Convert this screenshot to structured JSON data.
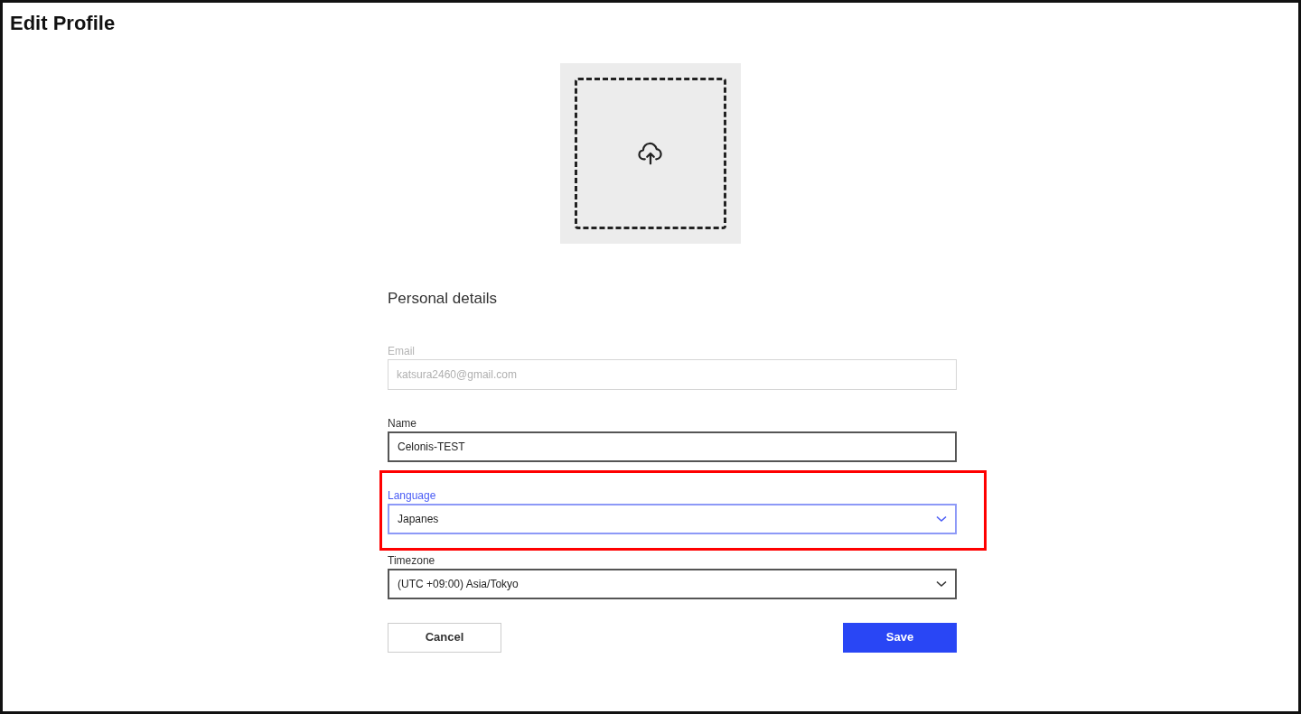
{
  "title": "Edit Profile",
  "section_title": "Personal details",
  "fields": [
    {
      "kind": "text",
      "label": "Email",
      "value": "katsura2460@gmail.com",
      "disabled": true,
      "focused": false,
      "highlighted": false
    },
    {
      "kind": "text",
      "label": "Name",
      "value": "Celonis-TEST",
      "disabled": false,
      "focused": false,
      "highlighted": false
    },
    {
      "kind": "select",
      "label": "Language",
      "value": "Japanes",
      "disabled": false,
      "focused": true,
      "highlighted": true
    },
    {
      "kind": "select",
      "label": "Timezone",
      "value": "(UTC +09:00) Asia/Tokyo",
      "disabled": false,
      "focused": false,
      "highlighted": false
    }
  ],
  "buttons": [
    {
      "label": "Cancel",
      "kind": "secondary"
    },
    {
      "label": "Save",
      "kind": "primary"
    }
  ]
}
